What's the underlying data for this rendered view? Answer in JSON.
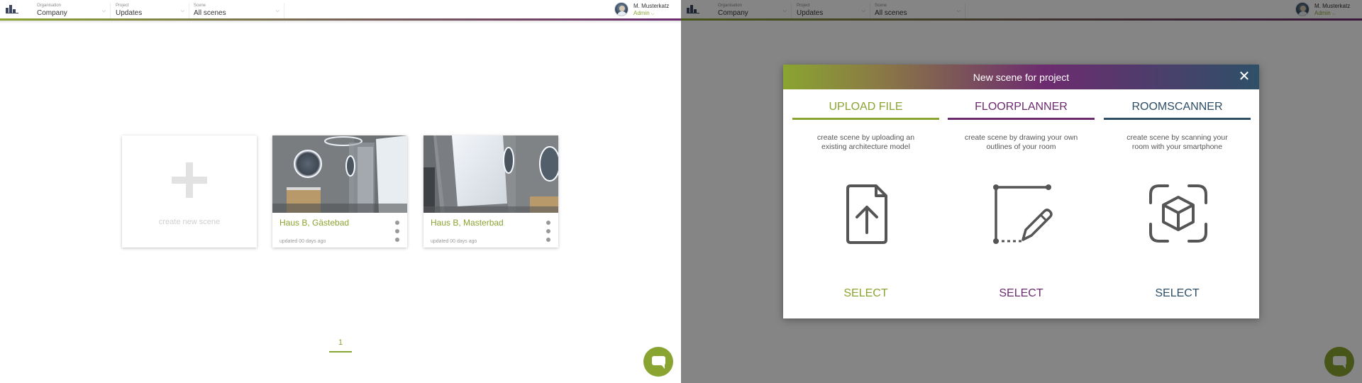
{
  "header": {
    "organisation": {
      "caption": "Organisation",
      "value": "Company"
    },
    "project": {
      "caption": "Project",
      "value": "Updates"
    },
    "scene": {
      "caption": "Scene",
      "value": "All scenes"
    },
    "user": {
      "name": "M. Musterkatz",
      "role": "Admin"
    }
  },
  "scenes": {
    "create_label": "create new scene",
    "items": [
      {
        "title": "Haus B, Gästebad",
        "updated": "updated 00 days ago"
      },
      {
        "title": "Haus B, Masterbad",
        "updated": "updated 00 days ago"
      }
    ]
  },
  "pagination": {
    "current": "1"
  },
  "modal": {
    "title": "New scene for project",
    "options": [
      {
        "tab": "UPLOAD FILE",
        "description": "create scene by uploading an existing architecture model",
        "select": "SELECT",
        "icon": "upload-file-icon",
        "color": "#8aa431"
      },
      {
        "tab": "FLOORPLANNER",
        "description": "create scene by drawing your own outlines of your room",
        "select": "SELECT",
        "icon": "floorplan-pencil-icon",
        "color": "#6d2b6f"
      },
      {
        "tab": "ROOMSCANNER",
        "description": "create scene by scanning your room with your smartphone",
        "select": "SELECT",
        "icon": "cube-scan-icon",
        "color": "#2e4e66"
      }
    ]
  },
  "icons": {
    "logo": "logo-icon",
    "chat": "chat-icon",
    "close": "close-icon",
    "chevron": "chevron-down-icon",
    "menu": "kebab-menu-icon"
  }
}
